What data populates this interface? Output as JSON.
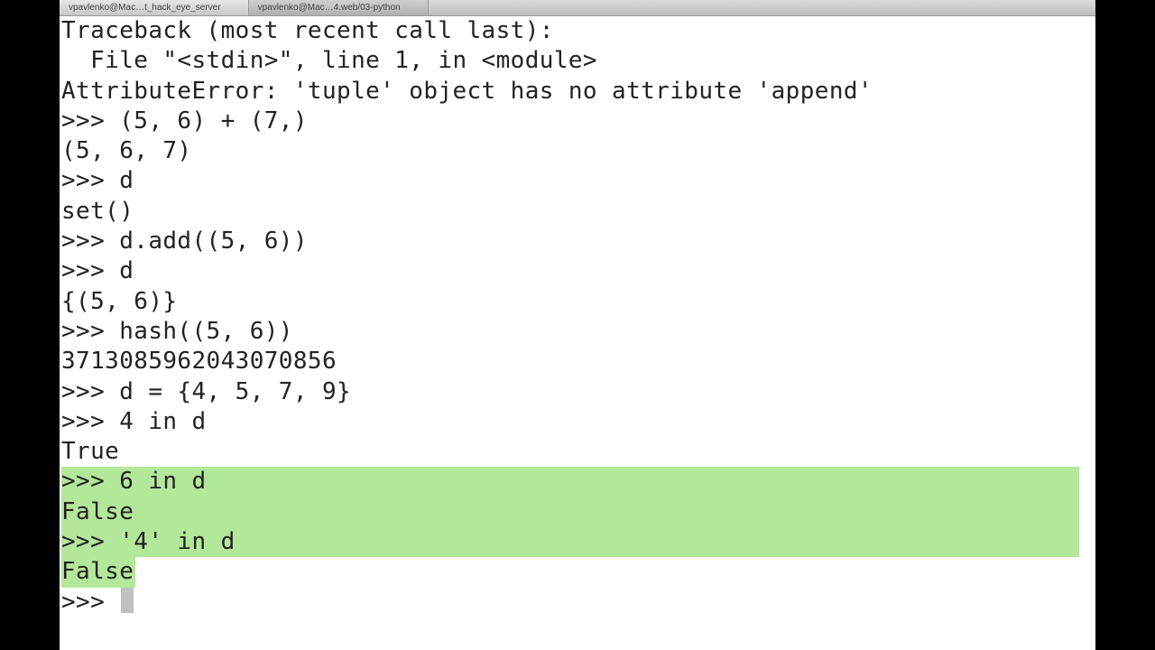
{
  "tabs": [
    {
      "label": "vpavlenko@Mac…t_hack_eye_server",
      "active": false
    },
    {
      "label": "vpavlenko@Mac…4.web/03-python",
      "active": true
    }
  ],
  "terminal": {
    "lines": [
      {
        "t": "Traceback (most recent call last):"
      },
      {
        "t": "  File \"<stdin>\", line 1, in <module>"
      },
      {
        "t": "AttributeError: 'tuple' object has no attribute 'append'"
      },
      {
        "t": ">>> (5, 6) + (7,)"
      },
      {
        "t": "(5, 6, 7)"
      },
      {
        "t": ">>> d"
      },
      {
        "t": "set()"
      },
      {
        "t": ">>> d.add((5, 6))"
      },
      {
        "t": ">>> d"
      },
      {
        "t": "{(5, 6)}"
      },
      {
        "t": ">>> hash((5, 6))"
      },
      {
        "t": "3713085962043070856"
      },
      {
        "t": ">>> d = {4, 5, 7, 9}"
      },
      {
        "t": ">>> 4 in d"
      },
      {
        "t": "True"
      },
      {
        "t": ">>> 6 in d",
        "sel": "block"
      },
      {
        "t": "False",
        "sel": "block"
      },
      {
        "t": ">>> '4' in d",
        "sel": "block"
      },
      {
        "t": "False",
        "sel": "word"
      },
      {
        "t": ">>> ",
        "cursor": true
      }
    ]
  }
}
